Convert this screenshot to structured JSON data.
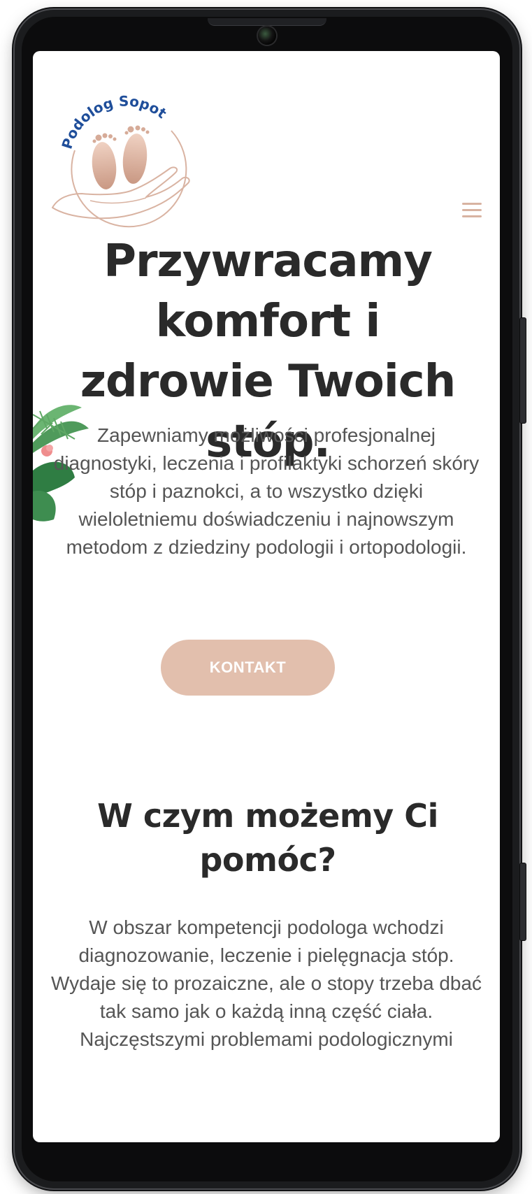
{
  "site": {
    "logo_text": "Podolog Sopot"
  },
  "nav": {
    "menu_icon": "hamburger-menu-icon"
  },
  "hero": {
    "title": "Przywracamy komfort i zdrowie Twoich stóp.",
    "text": "Zapewniamy możliwości profesjonalnej diagnostyki, leczenia i profilaktyki schorzeń skóry stóp i paznokci, a to wszystko dzięki wieloletniemu doświadczeniu i najnowszym metodom z dziedziny podologii i ortopodologii.",
    "button_label": "KONTAKT"
  },
  "help_section": {
    "title": "W czym możemy Ci pomóc?",
    "text": "W obszar kompetencji podologa wchodzi diagnozowanie, leczenie i pielęgnacja stóp. Wydaje się to prozaiczne, ale o stopy trzeba dbać tak samo jak o każdą inną część ciała. Najczęstszymi problemami podologicznymi"
  },
  "colors": {
    "accent": "#e2bfad",
    "menu": "#d8b3a1",
    "heading": "#2a2a2a",
    "body_text": "#555555",
    "logo_blue": "#1f4e9a"
  }
}
